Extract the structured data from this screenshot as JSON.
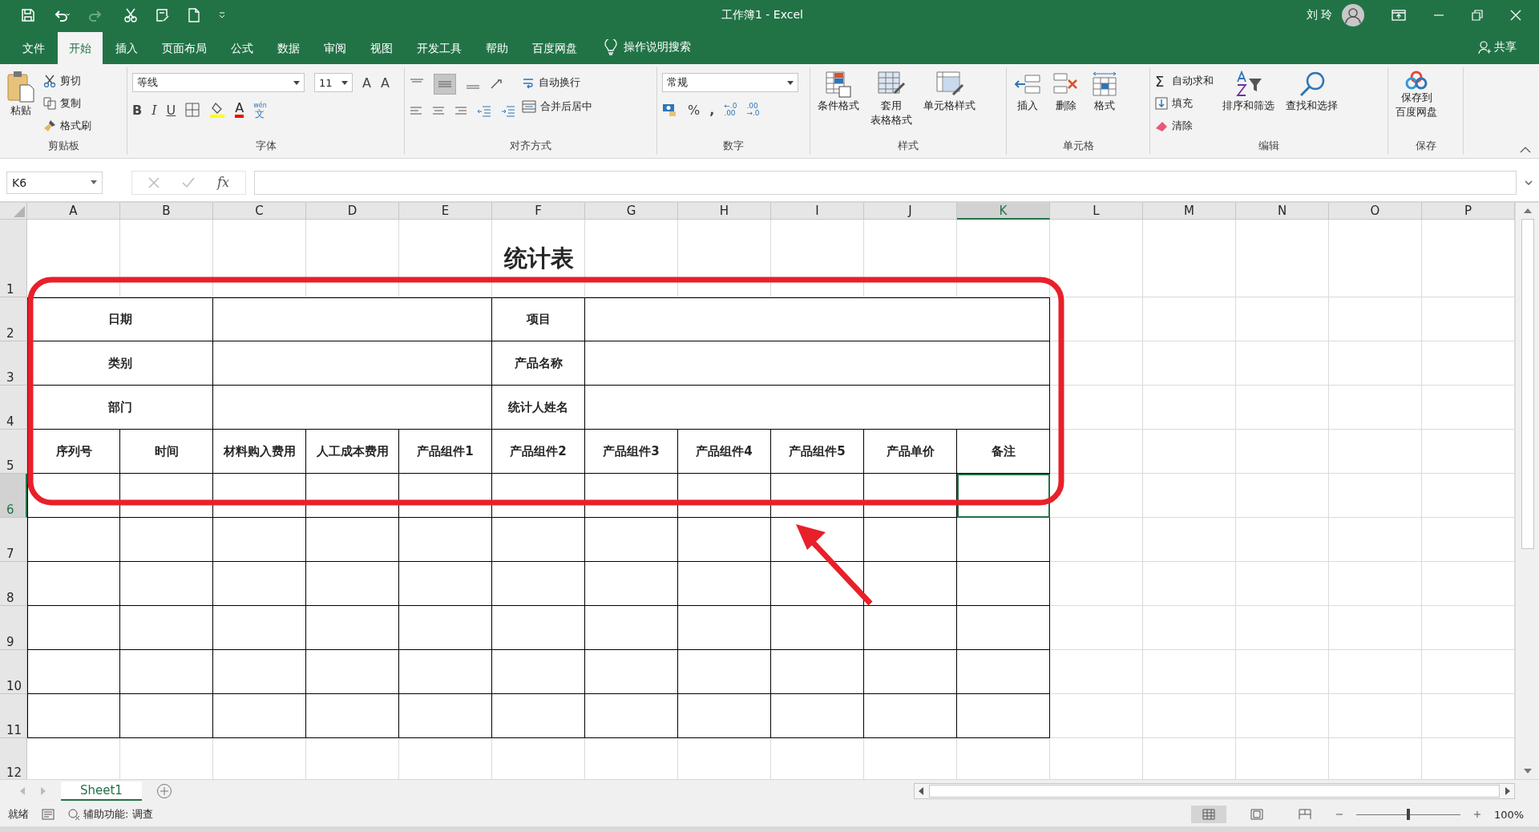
{
  "window": {
    "title": "工作簿1  -  Excel",
    "user": "刘 玲"
  },
  "ribbon_tabs": [
    {
      "label": "文件",
      "selected": false
    },
    {
      "label": "开始",
      "selected": true
    },
    {
      "label": "插入",
      "selected": false
    },
    {
      "label": "页面布局",
      "selected": false
    },
    {
      "label": "公式",
      "selected": false
    },
    {
      "label": "数据",
      "selected": false
    },
    {
      "label": "审阅",
      "selected": false
    },
    {
      "label": "视图",
      "selected": false
    },
    {
      "label": "开发工具",
      "selected": false
    },
    {
      "label": "帮助",
      "selected": false
    },
    {
      "label": "百度网盘",
      "selected": false
    }
  ],
  "tell_me": "操作说明搜索",
  "share": "共享",
  "clipboard": {
    "paste": "粘贴",
    "cut": "剪切",
    "copy": "复制",
    "format_painter": "格式刷",
    "label": "剪贴板"
  },
  "font": {
    "name": "等线",
    "size": "11",
    "grow": "A",
    "shrink": "A",
    "bold": "B",
    "italic": "I",
    "underline": "U",
    "font_color": "A",
    "phonetic": [
      "wén",
      "文"
    ],
    "label": "字体"
  },
  "alignment": {
    "wrap": "自动换行",
    "merge": "合并后居中",
    "label": "对齐方式"
  },
  "number": {
    "format": "常规",
    "percent": "%",
    "comma": ",",
    "increase_decimal": [
      "←.0",
      ".00"
    ],
    "decrease_decimal": [
      ".00",
      "→.0"
    ],
    "label": "数字"
  },
  "styles": {
    "conditional": "条件格式",
    "table_format": [
      "套用",
      "表格格式"
    ],
    "cell_styles": "单元格样式",
    "label": "样式"
  },
  "cells": {
    "insert": "插入",
    "delete": "删除",
    "format": "格式",
    "label": "单元格"
  },
  "editing": {
    "sigma": "Σ",
    "autosum": "自动求和",
    "fill": "填充",
    "clear": "清除",
    "sort": "排序和筛选",
    "find": "查找和选择",
    "label": "编辑"
  },
  "save": {
    "button": [
      "保存到",
      "百度网盘"
    ],
    "label": "保存"
  },
  "formula_bar": {
    "name_box": "K6",
    "fx": "fx"
  },
  "columns": [
    {
      "label": "A",
      "selected": false
    },
    {
      "label": "B",
      "selected": false
    },
    {
      "label": "C",
      "selected": false
    },
    {
      "label": "D",
      "selected": false
    },
    {
      "label": "E",
      "selected": false
    },
    {
      "label": "F",
      "selected": false
    },
    {
      "label": "G",
      "selected": false
    },
    {
      "label": "H",
      "selected": false
    },
    {
      "label": "I",
      "selected": false
    },
    {
      "label": "J",
      "selected": false
    },
    {
      "label": "K",
      "selected": true
    },
    {
      "label": "L",
      "selected": false
    },
    {
      "label": "M",
      "selected": false
    },
    {
      "label": "N",
      "selected": false
    },
    {
      "label": "O",
      "selected": false
    },
    {
      "label": "P",
      "selected": false
    }
  ],
  "rows": [
    {
      "label": "1",
      "selected": false
    },
    {
      "label": "2",
      "selected": false
    },
    {
      "label": "3",
      "selected": false
    },
    {
      "label": "4",
      "selected": false
    },
    {
      "label": "5",
      "selected": false
    },
    {
      "label": "6",
      "selected": true
    },
    {
      "label": "7",
      "selected": false
    },
    {
      "label": "8",
      "selected": false
    },
    {
      "label": "9",
      "selected": false
    },
    {
      "label": "10",
      "selected": false
    },
    {
      "label": "11",
      "selected": false
    },
    {
      "label": "12",
      "selected": false
    }
  ],
  "table": {
    "title": "统计表",
    "info_rows": [
      [
        "日期",
        "项目"
      ],
      [
        "类别",
        "产品名称"
      ],
      [
        "部门",
        "统计人姓名"
      ]
    ],
    "headers": [
      "序列号",
      "时间",
      "材料购入费用",
      "人工成本费用",
      "产品组件1",
      "产品组件2",
      "产品组件3",
      "产品组件4",
      "产品组件5",
      "产品单价",
      "备注"
    ]
  },
  "sheet_tabs": [
    {
      "label": "Sheet1",
      "selected": true
    }
  ],
  "status_bar": {
    "ready": "就绪",
    "accessibility": "辅助功能: 调查",
    "views": [
      {
        "kind": "normal",
        "selected": true
      },
      {
        "kind": "layout",
        "selected": false
      },
      {
        "kind": "break",
        "selected": false
      }
    ],
    "zoom": {
      "label": "100%",
      "level": 0.5
    }
  }
}
